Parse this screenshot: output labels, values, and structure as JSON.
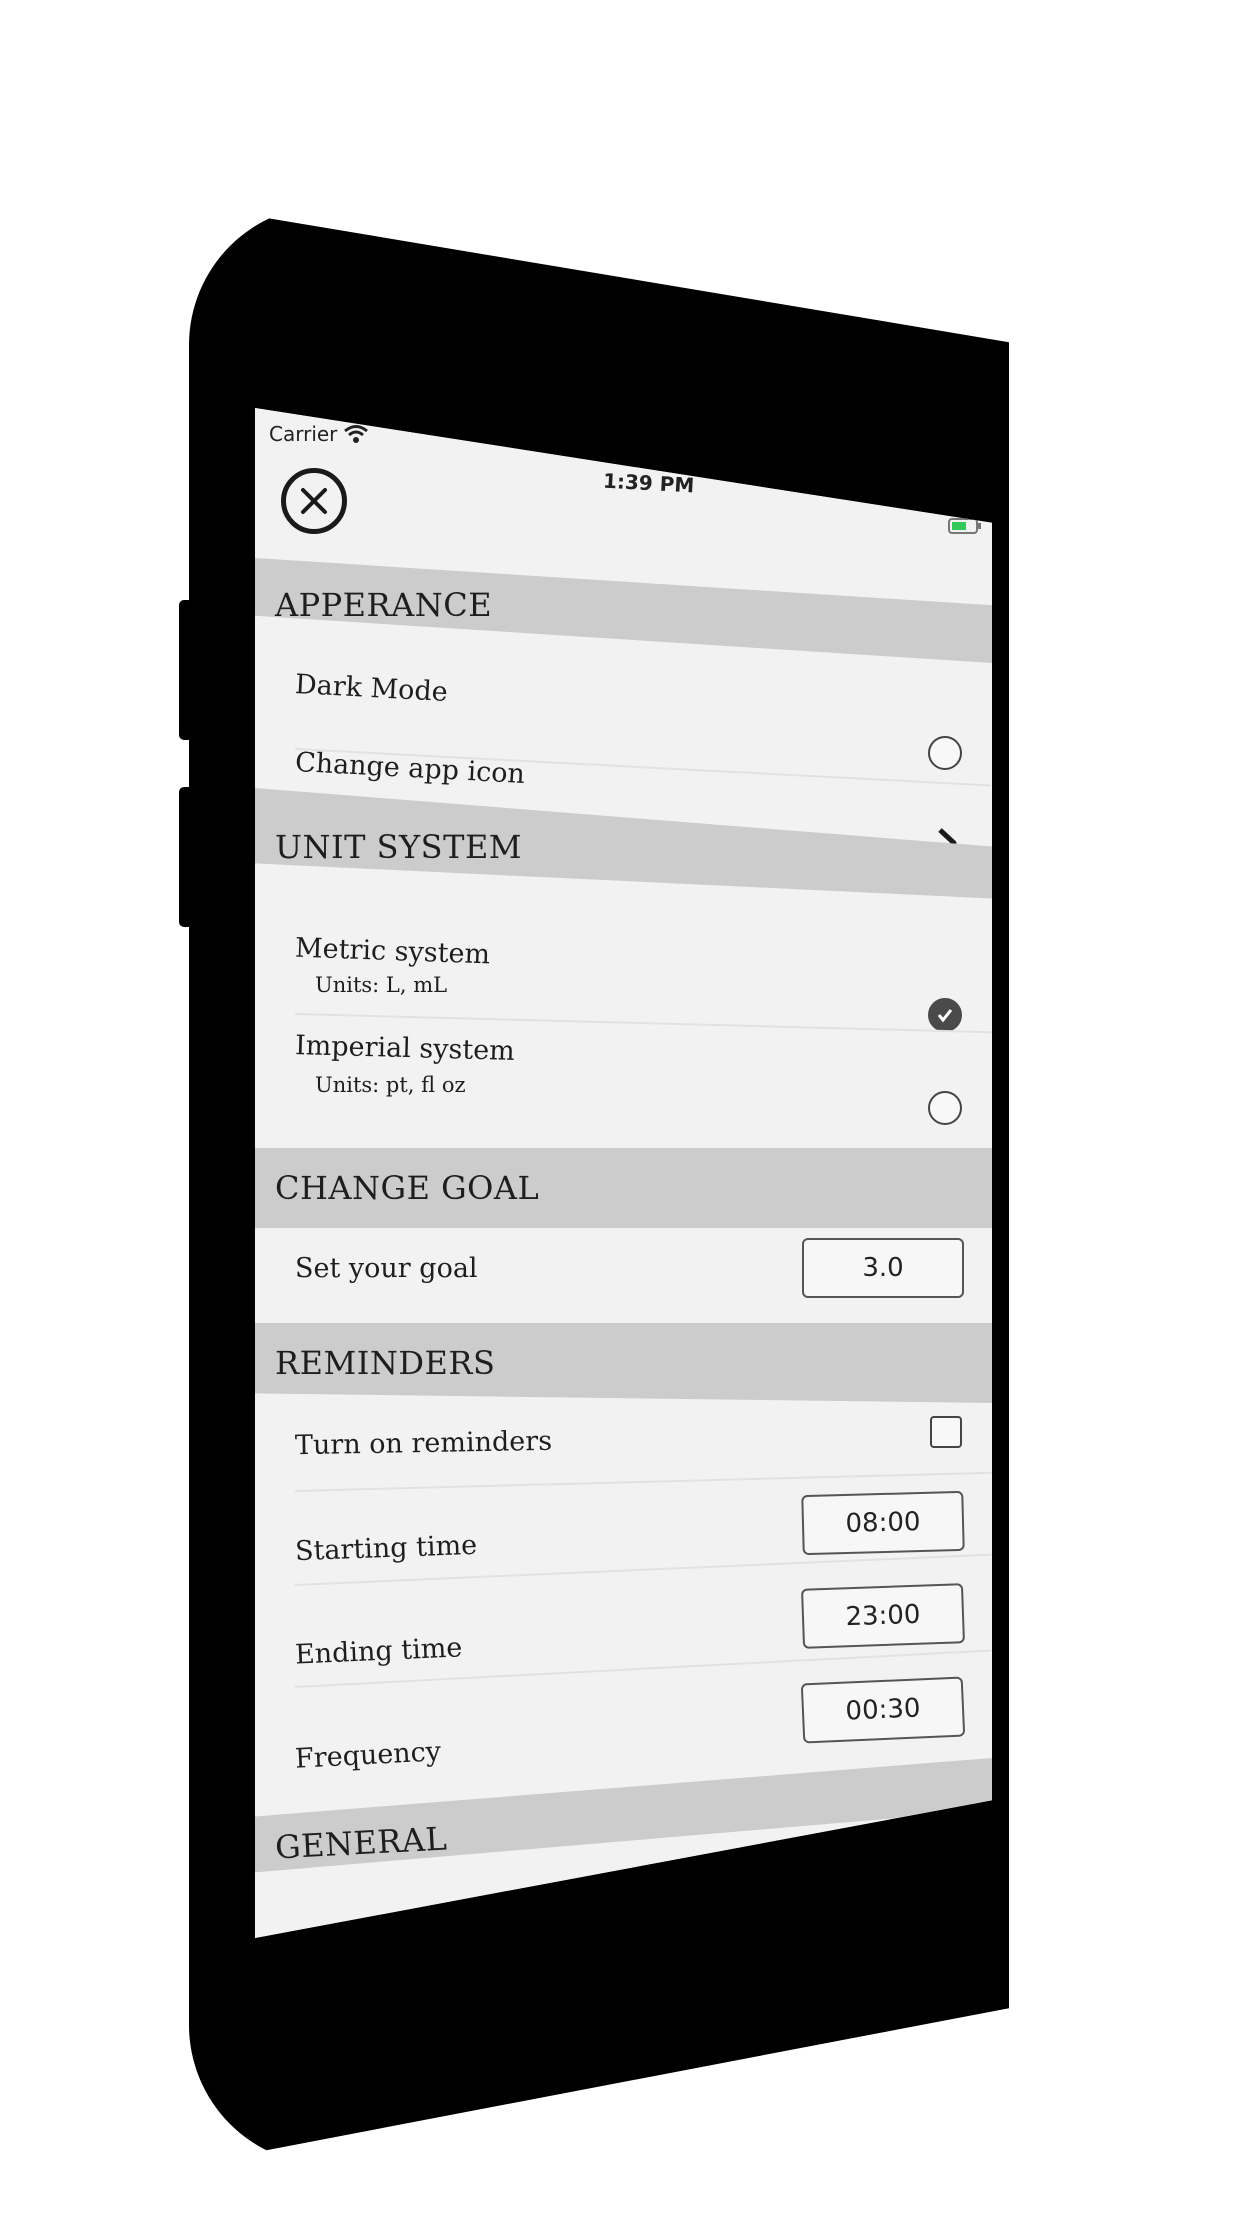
{
  "status_bar": {
    "carrier": "Carrier",
    "time": "1:39 PM"
  },
  "icons": {
    "close": "close-icon",
    "wifi": "wifi-icon",
    "battery": "battery-icon",
    "chevron": "chevron-right-icon"
  },
  "colors": {
    "section_bg": "#cccccc",
    "screen_bg": "#f2f2f2",
    "device": "#000000",
    "battery_charge": "#34c759"
  },
  "sections": {
    "appearance": {
      "header": "APPERANCE",
      "dark_mode": "Dark Mode",
      "dark_mode_checked": false,
      "change_icon": "Change app icon"
    },
    "unit_system": {
      "header": "UNIT SYSTEM",
      "metric": "Metric system",
      "metric_units": "Units: L, mL",
      "metric_checked": true,
      "imperial": "Imperial system",
      "imperial_units": "Units: pt, fl oz",
      "imperial_checked": false
    },
    "change_goal": {
      "header": "CHANGE GOAL",
      "label": "Set your goal",
      "value": "3.0"
    },
    "reminders": {
      "header": "REMINDERS",
      "toggle_label": "Turn on reminders",
      "toggle_checked": false,
      "start_label": "Starting time",
      "start_value": "08:00",
      "end_label": "Ending time",
      "end_value": "23:00",
      "frequency_label": "Frequency",
      "frequency_value": "00:30"
    },
    "general": {
      "header": "GENERAL"
    }
  }
}
